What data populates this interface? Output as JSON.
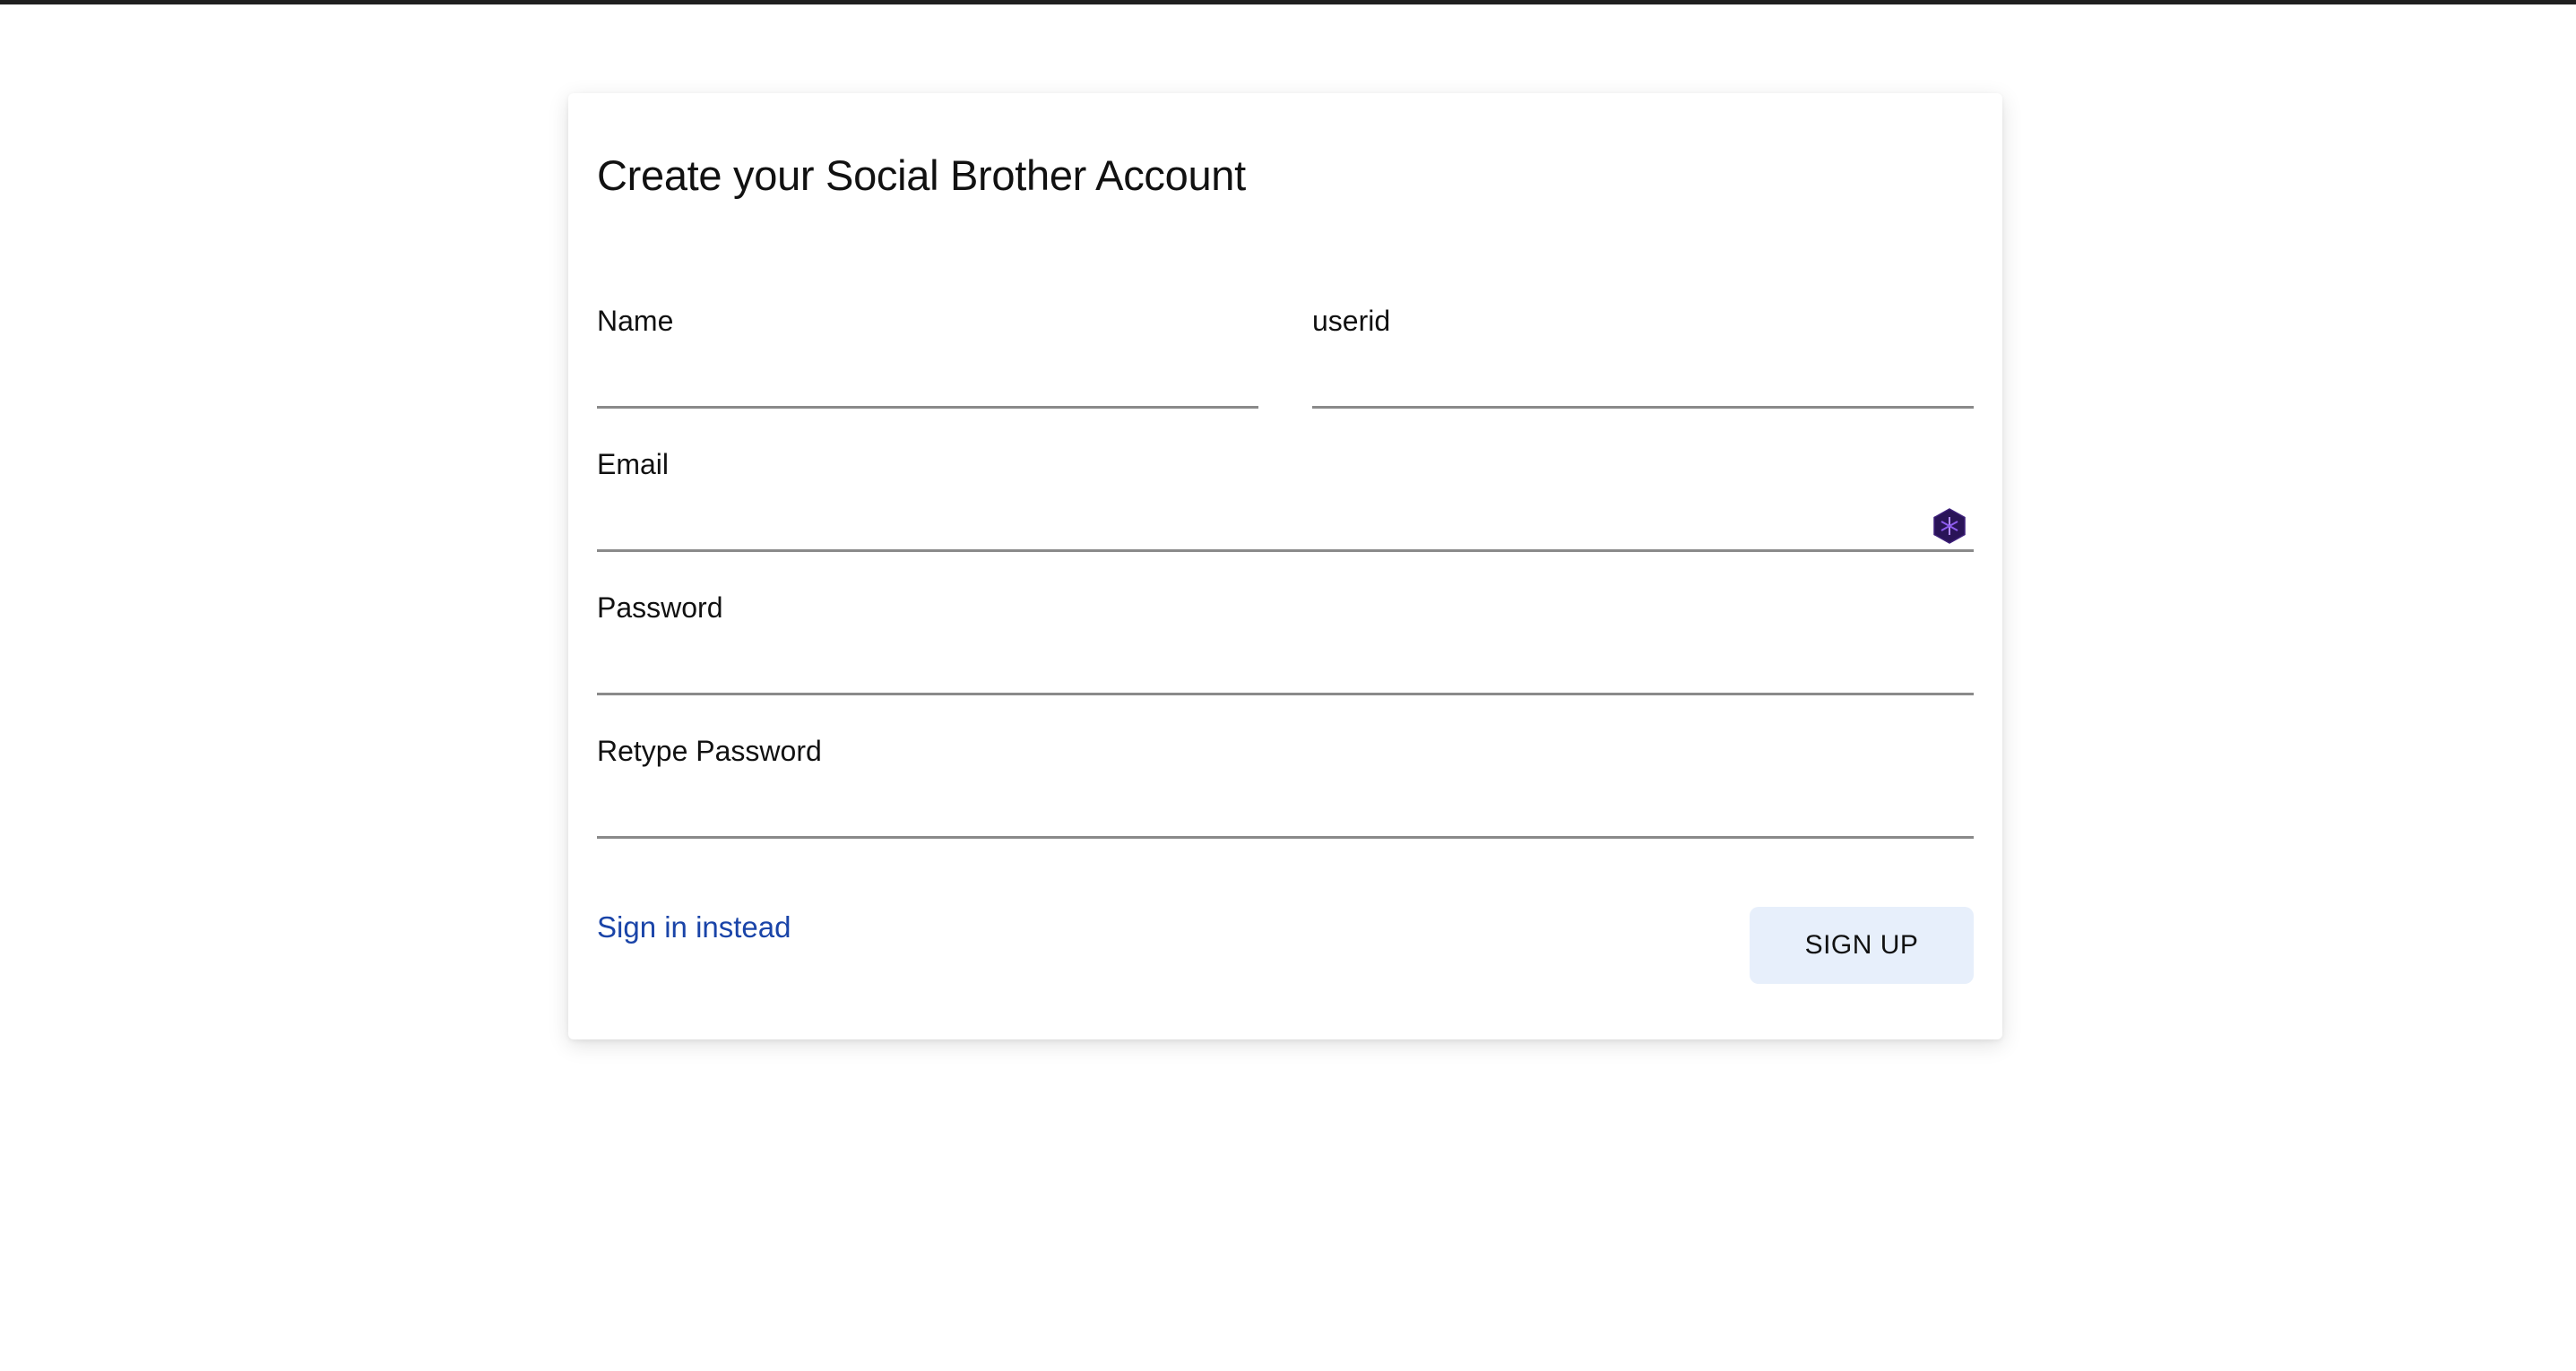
{
  "form": {
    "title": "Create your Social Brother Account",
    "fields": {
      "name": {
        "label": "Name",
        "value": ""
      },
      "userid": {
        "label": "userid",
        "value": ""
      },
      "email": {
        "label": "Email",
        "value": ""
      },
      "password": {
        "label": "Password",
        "value": ""
      },
      "retype_password": {
        "label": "Retype Password",
        "value": ""
      }
    },
    "signin_link": "Sign in instead",
    "signup_button": "SIGN UP"
  },
  "icons": {
    "email_field_extension": "password-manager-icon"
  },
  "colors": {
    "link": "#1a44a8",
    "button_bg": "#e7effb",
    "underline": "#8a8a8a",
    "icon_bg": "#2a1458",
    "icon_accent": "#8e5cf0"
  }
}
